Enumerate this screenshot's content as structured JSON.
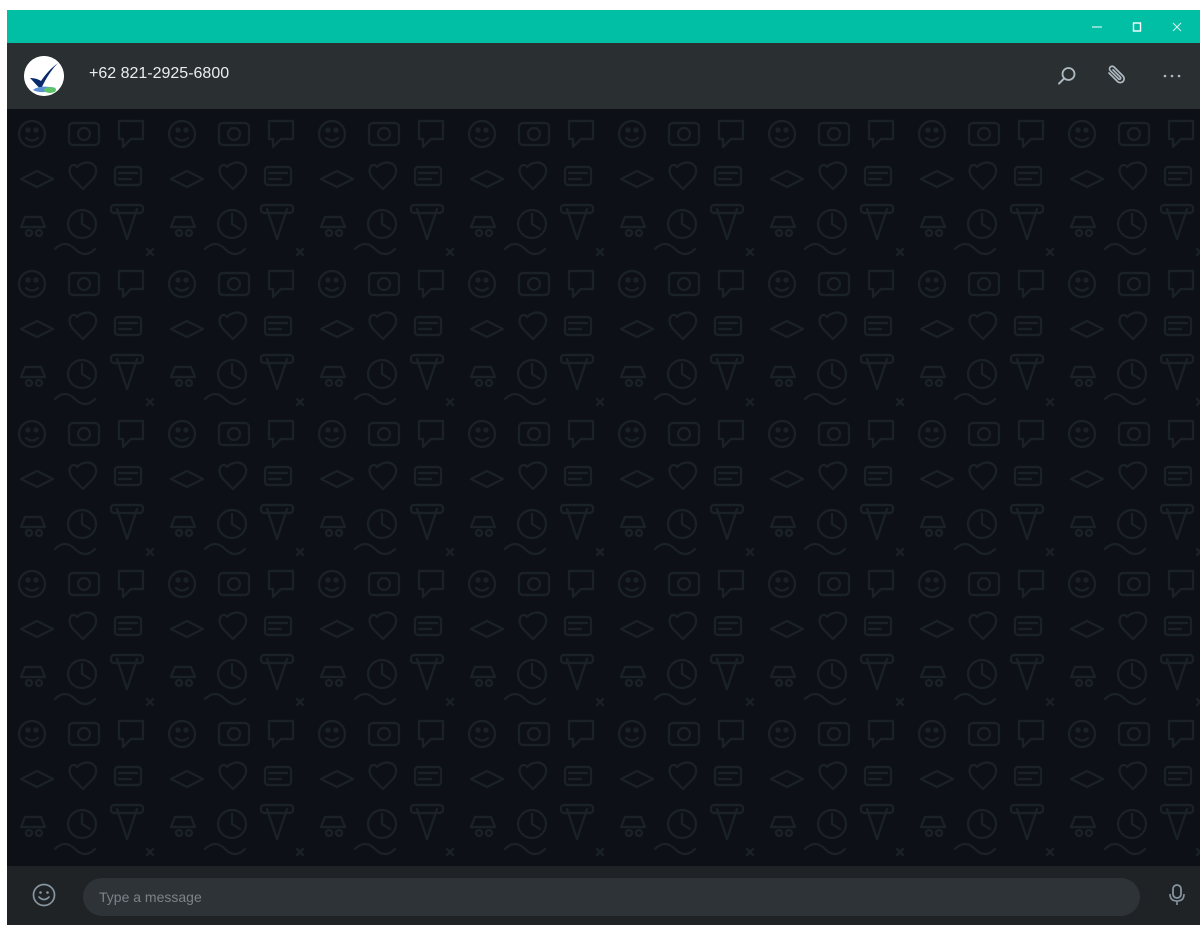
{
  "window": {
    "accent_color": "#00bfa5",
    "controls": {
      "minimize_icon": "minimize-icon",
      "maximize_icon": "maximize-icon",
      "close_icon": "close-icon"
    }
  },
  "chat_header": {
    "contact_name": "+62 821-2925-6800",
    "avatar_icon": "checkmark-logo-icon",
    "actions": {
      "search_icon": "search-icon",
      "attach_icon": "paperclip-icon",
      "menu_icon": "more-horizontal-icon"
    },
    "background_color": "#2a2f32"
  },
  "chat_area": {
    "background_color": "#0d1117",
    "wallpaper": "doodle-pattern"
  },
  "composer": {
    "emoji_icon": "emoji-icon",
    "input_placeholder": "Type a message",
    "input_value": "",
    "mic_icon": "microphone-icon"
  }
}
